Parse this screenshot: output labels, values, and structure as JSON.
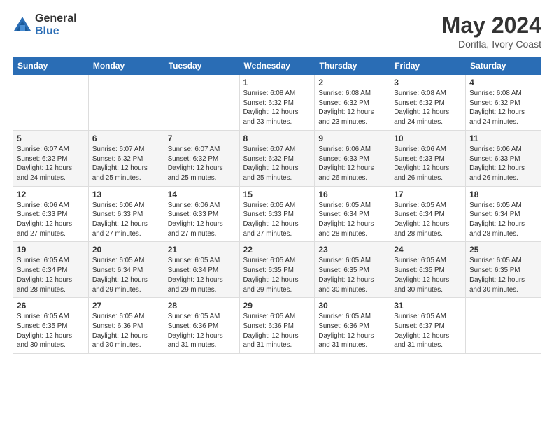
{
  "header": {
    "logo_general": "General",
    "logo_blue": "Blue",
    "month_year": "May 2024",
    "location": "Dorifla, Ivory Coast"
  },
  "days_of_week": [
    "Sunday",
    "Monday",
    "Tuesday",
    "Wednesday",
    "Thursday",
    "Friday",
    "Saturday"
  ],
  "weeks": [
    {
      "days": [
        {
          "number": "",
          "info": ""
        },
        {
          "number": "",
          "info": ""
        },
        {
          "number": "",
          "info": ""
        },
        {
          "number": "1",
          "info": "Sunrise: 6:08 AM\nSunset: 6:32 PM\nDaylight: 12 hours\nand 23 minutes."
        },
        {
          "number": "2",
          "info": "Sunrise: 6:08 AM\nSunset: 6:32 PM\nDaylight: 12 hours\nand 23 minutes."
        },
        {
          "number": "3",
          "info": "Sunrise: 6:08 AM\nSunset: 6:32 PM\nDaylight: 12 hours\nand 24 minutes."
        },
        {
          "number": "4",
          "info": "Sunrise: 6:08 AM\nSunset: 6:32 PM\nDaylight: 12 hours\nand 24 minutes."
        }
      ]
    },
    {
      "days": [
        {
          "number": "5",
          "info": "Sunrise: 6:07 AM\nSunset: 6:32 PM\nDaylight: 12 hours\nand 24 minutes."
        },
        {
          "number": "6",
          "info": "Sunrise: 6:07 AM\nSunset: 6:32 PM\nDaylight: 12 hours\nand 25 minutes."
        },
        {
          "number": "7",
          "info": "Sunrise: 6:07 AM\nSunset: 6:32 PM\nDaylight: 12 hours\nand 25 minutes."
        },
        {
          "number": "8",
          "info": "Sunrise: 6:07 AM\nSunset: 6:32 PM\nDaylight: 12 hours\nand 25 minutes."
        },
        {
          "number": "9",
          "info": "Sunrise: 6:06 AM\nSunset: 6:33 PM\nDaylight: 12 hours\nand 26 minutes."
        },
        {
          "number": "10",
          "info": "Sunrise: 6:06 AM\nSunset: 6:33 PM\nDaylight: 12 hours\nand 26 minutes."
        },
        {
          "number": "11",
          "info": "Sunrise: 6:06 AM\nSunset: 6:33 PM\nDaylight: 12 hours\nand 26 minutes."
        }
      ]
    },
    {
      "days": [
        {
          "number": "12",
          "info": "Sunrise: 6:06 AM\nSunset: 6:33 PM\nDaylight: 12 hours\nand 27 minutes."
        },
        {
          "number": "13",
          "info": "Sunrise: 6:06 AM\nSunset: 6:33 PM\nDaylight: 12 hours\nand 27 minutes."
        },
        {
          "number": "14",
          "info": "Sunrise: 6:06 AM\nSunset: 6:33 PM\nDaylight: 12 hours\nand 27 minutes."
        },
        {
          "number": "15",
          "info": "Sunrise: 6:05 AM\nSunset: 6:33 PM\nDaylight: 12 hours\nand 27 minutes."
        },
        {
          "number": "16",
          "info": "Sunrise: 6:05 AM\nSunset: 6:34 PM\nDaylight: 12 hours\nand 28 minutes."
        },
        {
          "number": "17",
          "info": "Sunrise: 6:05 AM\nSunset: 6:34 PM\nDaylight: 12 hours\nand 28 minutes."
        },
        {
          "number": "18",
          "info": "Sunrise: 6:05 AM\nSunset: 6:34 PM\nDaylight: 12 hours\nand 28 minutes."
        }
      ]
    },
    {
      "days": [
        {
          "number": "19",
          "info": "Sunrise: 6:05 AM\nSunset: 6:34 PM\nDaylight: 12 hours\nand 28 minutes."
        },
        {
          "number": "20",
          "info": "Sunrise: 6:05 AM\nSunset: 6:34 PM\nDaylight: 12 hours\nand 29 minutes."
        },
        {
          "number": "21",
          "info": "Sunrise: 6:05 AM\nSunset: 6:34 PM\nDaylight: 12 hours\nand 29 minutes."
        },
        {
          "number": "22",
          "info": "Sunrise: 6:05 AM\nSunset: 6:35 PM\nDaylight: 12 hours\nand 29 minutes."
        },
        {
          "number": "23",
          "info": "Sunrise: 6:05 AM\nSunset: 6:35 PM\nDaylight: 12 hours\nand 30 minutes."
        },
        {
          "number": "24",
          "info": "Sunrise: 6:05 AM\nSunset: 6:35 PM\nDaylight: 12 hours\nand 30 minutes."
        },
        {
          "number": "25",
          "info": "Sunrise: 6:05 AM\nSunset: 6:35 PM\nDaylight: 12 hours\nand 30 minutes."
        }
      ]
    },
    {
      "days": [
        {
          "number": "26",
          "info": "Sunrise: 6:05 AM\nSunset: 6:35 PM\nDaylight: 12 hours\nand 30 minutes."
        },
        {
          "number": "27",
          "info": "Sunrise: 6:05 AM\nSunset: 6:36 PM\nDaylight: 12 hours\nand 30 minutes."
        },
        {
          "number": "28",
          "info": "Sunrise: 6:05 AM\nSunset: 6:36 PM\nDaylight: 12 hours\nand 31 minutes."
        },
        {
          "number": "29",
          "info": "Sunrise: 6:05 AM\nSunset: 6:36 PM\nDaylight: 12 hours\nand 31 minutes."
        },
        {
          "number": "30",
          "info": "Sunrise: 6:05 AM\nSunset: 6:36 PM\nDaylight: 12 hours\nand 31 minutes."
        },
        {
          "number": "31",
          "info": "Sunrise: 6:05 AM\nSunset: 6:37 PM\nDaylight: 12 hours\nand 31 minutes."
        },
        {
          "number": "",
          "info": ""
        }
      ]
    }
  ]
}
